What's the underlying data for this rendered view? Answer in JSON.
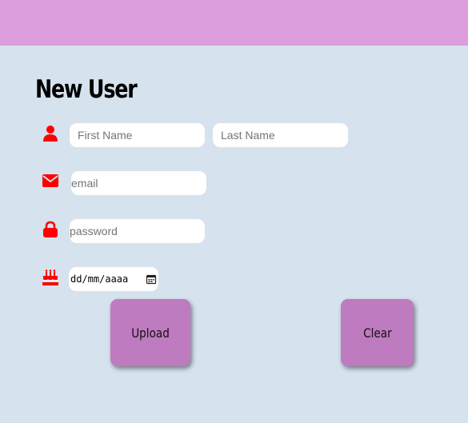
{
  "form": {
    "title": "New User",
    "first_name_placeholder": "First Name",
    "last_name_placeholder": "Last Name",
    "email_placeholder": "email",
    "password_placeholder": "password",
    "date_value": "dd/mm/aaaa"
  },
  "buttons": {
    "upload_label": "Upload",
    "clear_label": "Clear"
  },
  "icons": {
    "name": "user-icon",
    "email": "envelope-icon",
    "password": "lock-icon",
    "birthday": "birthday-cake-icon",
    "calendar": "calendar-icon"
  },
  "colors": {
    "header": "#dd9edd",
    "background": "#d6e2ee",
    "icon": "#ff0000",
    "button": "#bf7bbf"
  }
}
